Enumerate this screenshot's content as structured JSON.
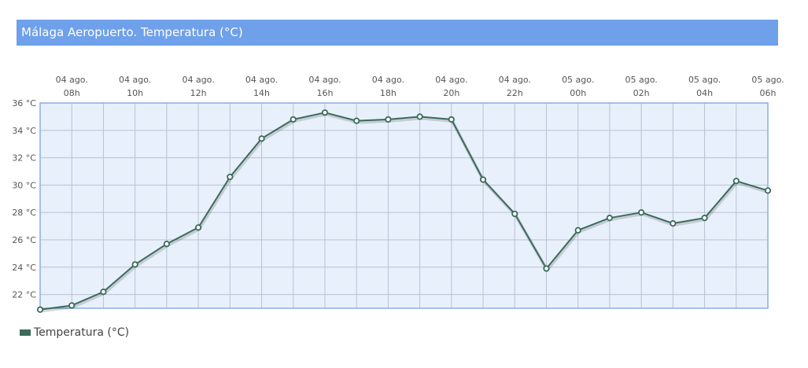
{
  "header": {
    "title": "Málaga Aeropuerto. Temperatura (°C)"
  },
  "colors": {
    "title_bar": "#6fa0ea",
    "plot_background": "#e8f0fc",
    "plot_border": "#8aaee6",
    "grid": "#b9c2d1",
    "series": "#3c6b5a",
    "marker_fill": "#ffffff"
  },
  "chart_data": {
    "type": "line",
    "title": "Málaga Aeropuerto. Temperatura (°C)",
    "xlabel": "",
    "ylabel": "",
    "ylim": [
      21,
      36
    ],
    "y_ticks": [
      "22 °C",
      "24 °C",
      "26 °C",
      "28 °C",
      "30 °C",
      "32 °C",
      "34 °C",
      "36 °C"
    ],
    "y_tick_values": [
      22,
      24,
      26,
      28,
      30,
      32,
      34,
      36
    ],
    "x_tick_labels": [
      [
        "04 ago.",
        "08h"
      ],
      [
        "04 ago.",
        "10h"
      ],
      [
        "04 ago.",
        "12h"
      ],
      [
        "04 ago.",
        "14h"
      ],
      [
        "04 ago.",
        "16h"
      ],
      [
        "04 ago.",
        "18h"
      ],
      [
        "04 ago.",
        "20h"
      ],
      [
        "04 ago.",
        "22h"
      ],
      [
        "05 ago.",
        "00h"
      ],
      [
        "05 ago.",
        "02h"
      ],
      [
        "05 ago.",
        "04h"
      ],
      [
        "05 ago.",
        "06h"
      ]
    ],
    "grid": true,
    "legend_position": "bottom-left",
    "x": [
      "04 ago. 07h",
      "04 ago. 08h",
      "04 ago. 09h",
      "04 ago. 10h",
      "04 ago. 11h",
      "04 ago. 12h",
      "04 ago. 13h",
      "04 ago. 14h",
      "04 ago. 15h",
      "04 ago. 16h",
      "04 ago. 17h",
      "04 ago. 18h",
      "04 ago. 19h",
      "04 ago. 20h",
      "04 ago. 21h",
      "04 ago. 22h",
      "04 ago. 23h",
      "05 ago. 00h",
      "05 ago. 01h",
      "05 ago. 02h",
      "05 ago. 03h",
      "05 ago. 04h",
      "05 ago. 05h",
      "05 ago. 06h"
    ],
    "series": [
      {
        "name": "Temperatura (°C)",
        "values": [
          20.9,
          21.2,
          22.2,
          24.2,
          25.7,
          26.9,
          30.6,
          33.4,
          34.8,
          35.3,
          34.7,
          34.8,
          35.0,
          34.8,
          30.4,
          27.9,
          23.9,
          26.7,
          27.6,
          28.0,
          27.2,
          27.6,
          30.3,
          29.6
        ]
      }
    ]
  }
}
